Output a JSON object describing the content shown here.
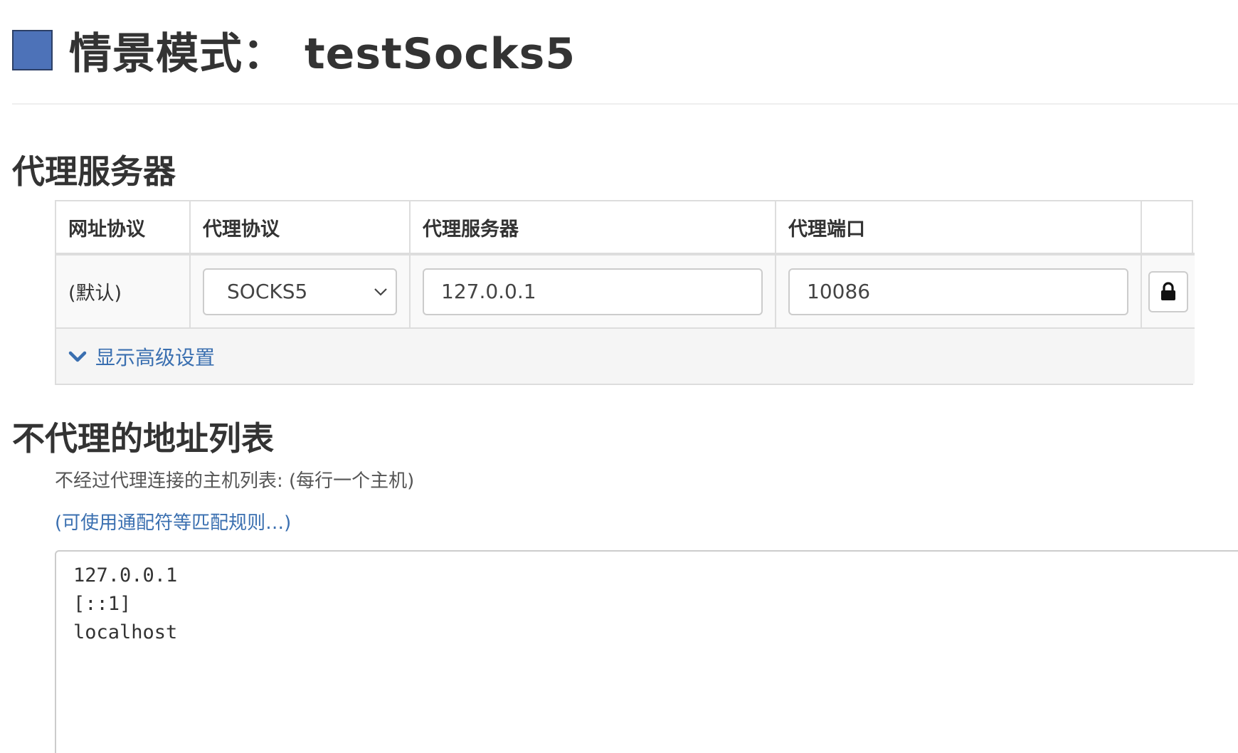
{
  "header": {
    "title_prefix": "情景模式：",
    "profile_name": "testSocks5",
    "profile_color": "#4d72b8"
  },
  "proxy_section": {
    "heading": "代理服务器",
    "columns": [
      "网址协议",
      "代理协议",
      "代理服务器",
      "代理端口",
      ""
    ],
    "row": {
      "scheme": "(默认)",
      "protocol": "SOCKS5",
      "host": "127.0.0.1",
      "port": "10086"
    },
    "advanced_label": "显示高级设置"
  },
  "bypass_section": {
    "heading": "不代理的地址列表",
    "help_text": "不经过代理连接的主机列表: (每行一个主机)",
    "wildcard_link": "(可使用通配符等匹配规则…)",
    "lines": [
      "127.0.0.1",
      "[::1]",
      "localhost"
    ]
  },
  "icons": {
    "lock": "lock-icon",
    "chevron_down": "chevron-down-icon",
    "select_arrow": "select-arrow-icon"
  },
  "colors": {
    "link": "#3a6fb0",
    "border": "#dddddd"
  }
}
